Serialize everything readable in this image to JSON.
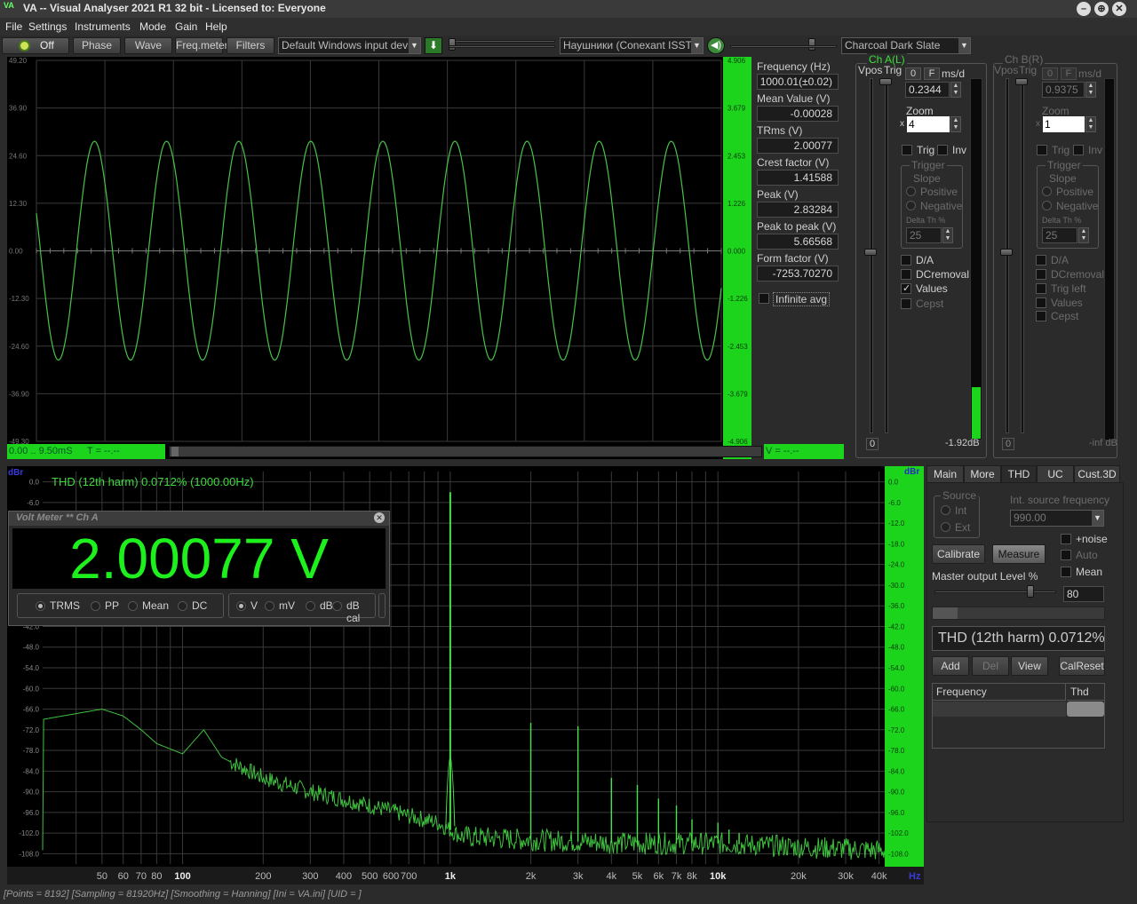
{
  "window": {
    "title": "VA -- Visual Analyser 2021 R1 32 bit - Licensed to: Everyone",
    "logo_text": "VA"
  },
  "menu": [
    "File",
    "Settings",
    "Instruments",
    "Mode",
    "Gain",
    "Help"
  ],
  "toolbar": {
    "power_label": "Off",
    "buttons": [
      "Phase",
      "Wave",
      "Freq.meter",
      "Filters"
    ],
    "input_device": "Default Windows input device",
    "output_device": "Наушники (Conexant ISST Au",
    "theme": "Charcoal Dark Slate"
  },
  "scope": {
    "y_ticks_left": [
      "49.20",
      "36.90",
      "24.60",
      "12.30",
      "0.00",
      "-12.30",
      "-24.60",
      "-36.90",
      "-49.30"
    ],
    "y_ticks_right": [
      "4.906",
      "3.679",
      "2.453",
      "1.226",
      "0.000",
      "-1.226",
      "-2.453",
      "-3.679",
      "-4.906"
    ],
    "time_range": "0.00 .. 9.50mS",
    "t_readout": "T = --.--",
    "v_readout": "V = --.--",
    "trace_color": "#4ac24a",
    "axis_color": "#1dd41d"
  },
  "measurements": [
    {
      "label": "Frequency (Hz)",
      "value": "1000.01(±0.02)"
    },
    {
      "label": "Mean Value (V)",
      "value": "-0.00028"
    },
    {
      "label": "TRms (V)",
      "value": "2.00077"
    },
    {
      "label": "Crest factor (V)",
      "value": "1.41588"
    },
    {
      "label": "Peak (V)",
      "value": "2.83284"
    },
    {
      "label": "Peak to peak (V)",
      "value": "5.66568"
    },
    {
      "label": "Form factor (V)",
      "value": "-7253.70270"
    }
  ],
  "infinite_avg_label": "Infinite avg",
  "channel_a": {
    "title": "Ch A(L)",
    "vpos": "Vpos",
    "trig": "Trig",
    "o": "0",
    "f": "F",
    "msd": "ms/d",
    "msd_value": "0.2344",
    "zoom_label": "Zoom",
    "x_label": "x",
    "zoom_value": "4",
    "trig_label": "Trig",
    "inv_label": "Inv",
    "trigger_label": "Trigger",
    "slope_label": "Slope",
    "positive": "Positive",
    "negative": "Negative",
    "delta_th": "Delta Th %",
    "delta_value": "25",
    "options": [
      "D/A",
      "DCremoval",
      "Values",
      "Cepst"
    ],
    "bottom_left": "0",
    "level": "-1.92dB"
  },
  "channel_b": {
    "title": "Ch B(R)",
    "vpos": "Vpos",
    "trig": "Trig",
    "o": "0",
    "f": "F",
    "msd": "ms/d",
    "msd_value": "0.9375",
    "zoom_label": "Zoom",
    "x_label": "x",
    "zoom_value": "1",
    "trig_label": "Trig",
    "inv_label": "Inv",
    "trigger_label": "Trigger",
    "slope_label": "Slope",
    "positive": "Positive",
    "negative": "Negative",
    "delta_th": "Delta Th %",
    "delta_value": "25",
    "options": [
      "D/A",
      "DCremoval",
      "Trig left",
      "Values",
      "Cepst"
    ],
    "bottom_left": "0",
    "level": "-inf dB"
  },
  "spectrum": {
    "unit_left": "dBr",
    "unit_right": "dBr",
    "thd_text": "THD (12th harm) 0.0712% (1000.00Hz)",
    "y_ticks": [
      "0.0",
      "-6.0",
      "-12.0",
      "-18.0",
      "-24.0",
      "-30.0",
      "-36.0",
      "-42.0",
      "-48.0",
      "-54.0",
      "-60.0",
      "-66.0",
      "-72.0",
      "-78.0",
      "-84.0",
      "-90.0",
      "-96.0",
      "-102.0",
      "-108.0"
    ],
    "y_ticks_right": [
      "0.0",
      "-6.0",
      "-12.0",
      "-18.0",
      "-24.0",
      "-30.0",
      "-36.0",
      "-42.0",
      "-48.0",
      "-54.0",
      "-60.0",
      "-66.0",
      "-72.0",
      "-78.0",
      "-84.0",
      "-90.0",
      "-96.0",
      "-102.0",
      "-108.0"
    ],
    "x_ticks": [
      "50",
      "60",
      "70",
      "80",
      "100",
      "200",
      "300",
      "400",
      "500",
      "600",
      "700",
      "1k",
      "2k",
      "3k",
      "4k",
      "5k",
      "6k",
      "7k",
      "8k",
      "10k",
      "20k",
      "30k",
      "40k"
    ],
    "x_unit": "Hz"
  },
  "voltmeter": {
    "title": "Volt Meter ** Ch A",
    "reading": "2.00077 V",
    "modes": [
      "TRMS",
      "PP",
      "Mean",
      "DC"
    ],
    "units": [
      "V",
      "mV",
      "dB",
      "dB cal"
    ]
  },
  "right_panel": {
    "tabs": [
      "Main",
      "More",
      "THD",
      "UC",
      "Cust.3D"
    ],
    "source_label": "Source",
    "int_label": "Int",
    "ext_label": "Ext",
    "int_freq_label": "Int. source frequency",
    "int_freq_value": "990.00",
    "noise_label": "+noise",
    "auto_label": "Auto",
    "mean_label": "Mean",
    "calibrate": "Calibrate",
    "measure": "Measure",
    "master_level_label": "Master output Level %",
    "master_level_value": "80",
    "thd_display": "THD (12th harm) 0.0712%",
    "buttons": [
      "Add",
      "Del",
      "View",
      "CalReset"
    ],
    "table_headers": [
      "Frequency",
      "Thd (%)"
    ]
  },
  "status_bar": "[Points = 8192]  [Sampling = 81920Hz]  [Smoothing = Hanning]  [Ini = VA.ini]  [UID = ]",
  "chart_data": [
    {
      "type": "line",
      "title": "",
      "xlabel": "",
      "ylabel": "",
      "x_range_ms": [
        0,
        9.5
      ],
      "ylim": [
        -49.3,
        49.2
      ],
      "series": [
        {
          "frequency_hz": 1000,
          "amplitude": 28.3,
          "phase_deg": 160
        }
      ]
    },
    {
      "type": "line",
      "title": "THD (12th harm) 0.0712% (1000.00Hz)",
      "xlabel": "Hz",
      "ylabel": "dBr",
      "x_scale": "log",
      "ylim": [
        -111,
        3
      ],
      "noise_floor": [
        [
          30,
          -69
        ],
        [
          50,
          -66
        ],
        [
          60,
          -68
        ],
        [
          70,
          -72
        ],
        [
          80,
          -76
        ],
        [
          100,
          -79
        ],
        [
          120,
          -72
        ],
        [
          140,
          -80
        ],
        [
          200,
          -86
        ],
        [
          300,
          -90
        ],
        [
          500,
          -94
        ],
        [
          700,
          -97
        ],
        [
          900,
          -99
        ],
        [
          1100,
          -103
        ],
        [
          2000,
          -104
        ],
        [
          5000,
          -105
        ],
        [
          10000,
          -105
        ],
        [
          20000,
          -106
        ],
        [
          40000,
          -107
        ]
      ],
      "peaks": [
        [
          1000,
          -3
        ],
        [
          2000,
          -70
        ],
        [
          3000,
          -71
        ],
        [
          4000,
          -86
        ],
        [
          5000,
          -88
        ],
        [
          6000,
          -92
        ],
        [
          7000,
          -94
        ],
        [
          8000,
          -98
        ],
        [
          10000,
          -99
        ],
        [
          11000,
          -101
        ],
        [
          12000,
          -102
        ]
      ]
    }
  ]
}
